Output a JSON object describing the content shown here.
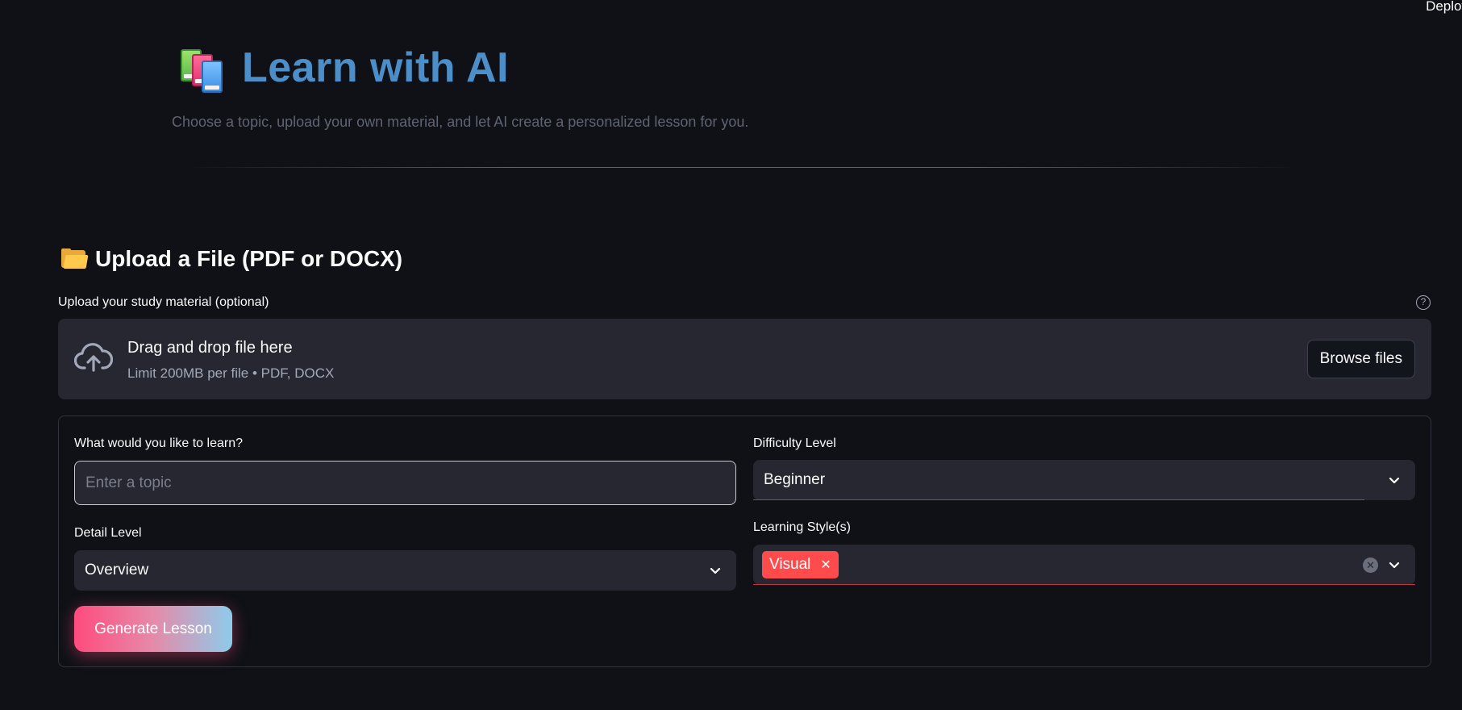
{
  "header": {
    "deploy_label": "Deploy"
  },
  "hero": {
    "icon": "books-icon",
    "title": "Learn with AI",
    "subtitle": "Choose a topic, upload your own material, and let AI create a personalized lesson for you."
  },
  "upload_section": {
    "icon": "folder-icon",
    "title": "Upload a File (PDF or DOCX)",
    "label": "Upload your study material (optional)",
    "help_icon": "help-icon",
    "dropzone_title": "Drag and drop file here",
    "dropzone_limit": "Limit 200MB per file • PDF, DOCX",
    "browse_label": "Browse files"
  },
  "form": {
    "topic_label": "What would you like to learn?",
    "topic_value": "",
    "topic_placeholder": "Enter a topic",
    "difficulty_label": "Difficulty Level",
    "difficulty_value": "Beginner",
    "detail_label": "Detail Level",
    "detail_value": "Overview",
    "style_label": "Learning Style(s)",
    "style_tags": [
      "Visual"
    ],
    "tag_remove_glyph": "✕",
    "clear_glyph": "✕",
    "generate_label": "Generate Lesson"
  },
  "colors": {
    "background": "#0f1117",
    "title_blue": "#4b8ec8",
    "accent_red": "#ff4b4b",
    "input_bg": "#262730"
  }
}
